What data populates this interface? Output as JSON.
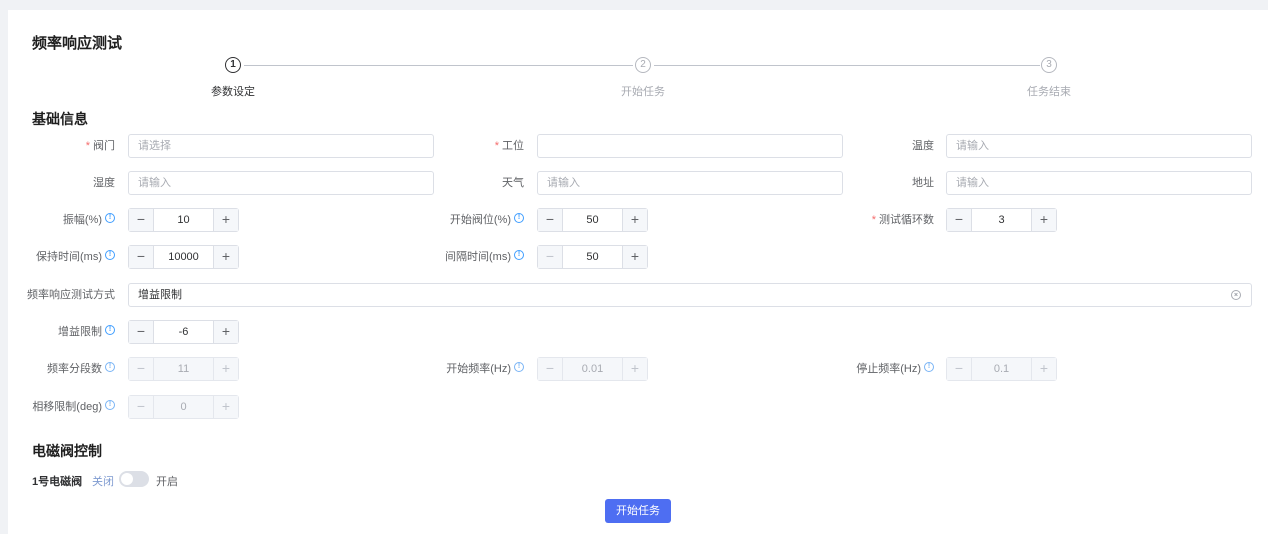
{
  "page": {
    "title": "频率响应测试"
  },
  "steps": [
    {
      "number": "1",
      "label": "参数设定"
    },
    {
      "number": "2",
      "label": "开始任务"
    },
    {
      "number": "3",
      "label": "任务结束"
    }
  ],
  "basic": {
    "title": "基础信息",
    "valve": {
      "label": "阀门",
      "placeholder": "请选择"
    },
    "station": {
      "label": "工位",
      "value": ""
    },
    "temperature": {
      "label": "温度",
      "placeholder": "请输入"
    },
    "humidity": {
      "label": "湿度",
      "placeholder": "请输入"
    },
    "weather": {
      "label": "天气",
      "placeholder": "请输入"
    },
    "address": {
      "label": "地址",
      "placeholder": "请输入"
    },
    "amplitude": {
      "label": "振幅(%)",
      "value": "10"
    },
    "start_position": {
      "label": "开始阀位(%)",
      "value": "50"
    },
    "cycles": {
      "label": "测试循环数",
      "value": "3"
    },
    "hold_time": {
      "label": "保持时间(ms)",
      "value": "10000"
    },
    "interval_time": {
      "label": "间隔时间(ms)",
      "value": "50"
    },
    "test_method": {
      "label": "频率响应测试方式",
      "value": "增益限制"
    },
    "gain_limit": {
      "label": "增益限制",
      "value": "-6"
    },
    "freq_segments": {
      "label": "频率分段数",
      "value": "11"
    },
    "start_freq": {
      "label": "开始频率(Hz)",
      "value": "0.01"
    },
    "stop_freq": {
      "label": "停止频率(Hz)",
      "value": "0.1"
    },
    "phase_limit": {
      "label": "相移限制(deg)",
      "value": "0"
    }
  },
  "solenoid": {
    "title": "电磁阀控制",
    "item_label": "1号电磁阀",
    "off_text": "关闭",
    "on_text": "开启",
    "state": "off"
  },
  "actions": {
    "start_task": "开始任务"
  },
  "icons": {
    "tip": "info-circle-icon",
    "minus": "minus-icon",
    "plus": "plus-icon",
    "clear": "circle-close-icon"
  },
  "colors": {
    "primary": "#4e6ef2",
    "required": "#f56c6c",
    "tip": "#409eff"
  }
}
